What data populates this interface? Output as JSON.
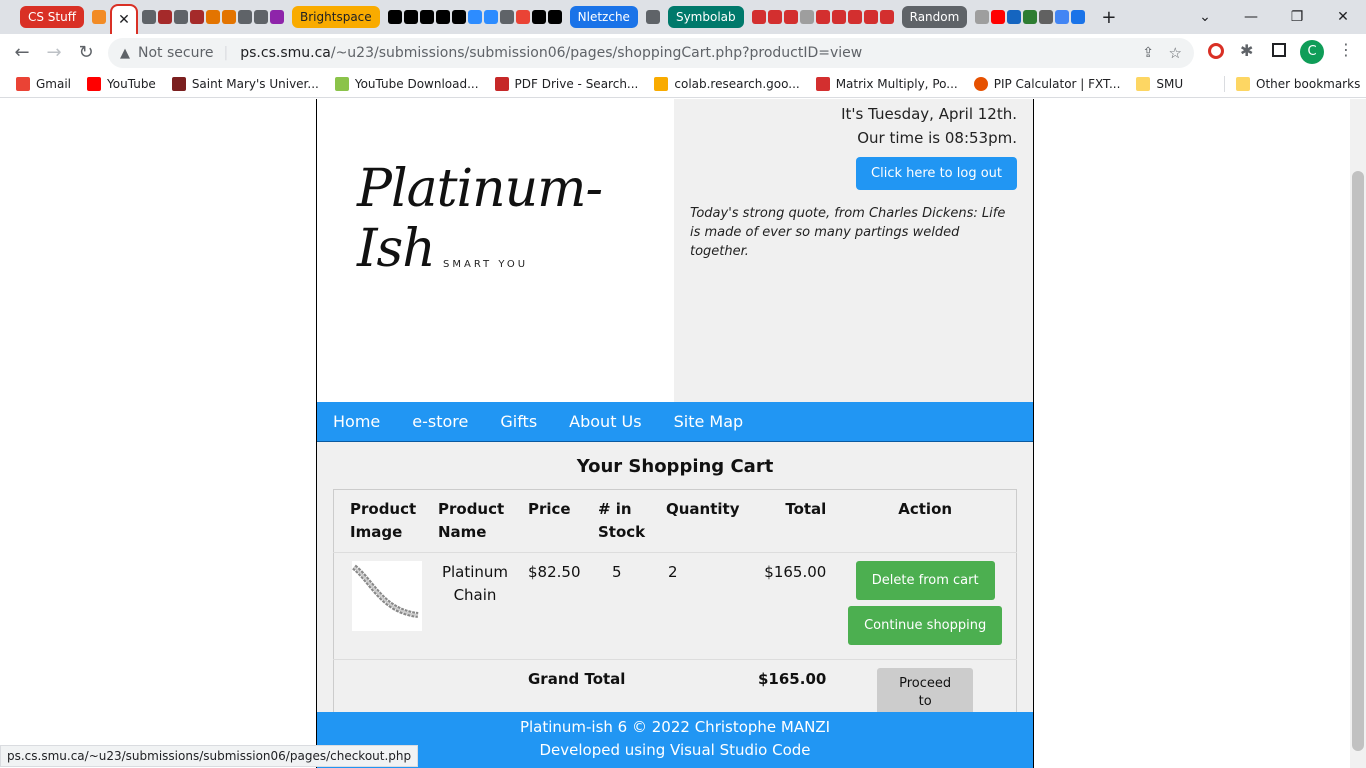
{
  "browser": {
    "tab_groups": {
      "cs_stuff": "CS Stuff",
      "brightspace": "Brightspace",
      "nletzche": "Nletzche",
      "symbolab": "Symbolab",
      "random": "Random"
    },
    "security_label": "Not secure",
    "url_host": "ps.cs.smu.ca",
    "url_path": "/~u23/submissions/submission06/pages/shoppingCart.php?productID=view",
    "profile_initial": "C",
    "bookmarks": [
      {
        "label": "Gmail"
      },
      {
        "label": "YouTube"
      },
      {
        "label": "Saint Mary's Univer..."
      },
      {
        "label": "YouTube Download..."
      },
      {
        "label": "PDF Drive - Search..."
      },
      {
        "label": "colab.research.goo..."
      },
      {
        "label": "Matrix Multiply, Po..."
      },
      {
        "label": "PIP Calculator | FXT..."
      },
      {
        "label": "SMU"
      }
    ],
    "other_bookmarks": "Other bookmarks",
    "status_url": "ps.cs.smu.ca/~u23/submissions/submission06/pages/checkout.php"
  },
  "site": {
    "logo_text": "Platinum-Ish",
    "logo_tagline": "SMART YOU",
    "date_line": "It's Tuesday, April 12th.",
    "time_line": "Our time is 08:53pm.",
    "logout_label": "Click here to log out",
    "quote": "Today's strong quote, from Charles Dickens: Life is made of ever so many partings welded together.",
    "nav": [
      "Home",
      "e-store",
      "Gifts",
      "About Us",
      "Site Map"
    ],
    "cart_title": "Your Shopping Cart",
    "columns": [
      "Product Image",
      "Product Name",
      "Price",
      "# in Stock",
      "Quantity",
      "Total",
      "Action"
    ],
    "item": {
      "name": "Platinum Chain",
      "price": "$82.50",
      "stock": "5",
      "quantity": "2",
      "total": "$165.00",
      "delete_label": "Delete from cart",
      "continue_label": "Continue shopping"
    },
    "grand_total_label": "Grand Total",
    "grand_total_value": "$165.00",
    "checkout_label": "Proceed to checkout",
    "footer_line1": "Platinum-ish 6 © 2022 Christophe MANZI",
    "footer_line2": "Developed using Visual Studio Code"
  }
}
